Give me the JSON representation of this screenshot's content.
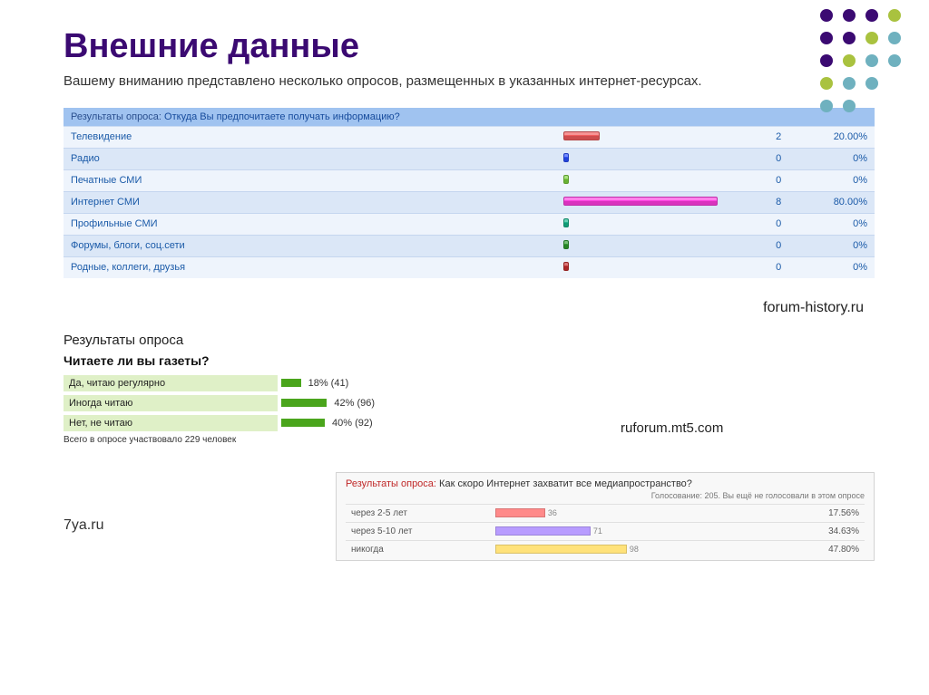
{
  "title": "Внешние данные",
  "subtitle": "Вашему вниманию представлено несколько опросов, размещенных в указанных интернет-ресурсах.",
  "poll1": {
    "headerPrefix": "Результаты опроса:",
    "question": "Откуда Вы предпочитаете получать информацию?",
    "rows": [
      {
        "label": "Телевидение",
        "count": "2",
        "pct": "20.00%",
        "barW": 40,
        "color": "#f15b5b"
      },
      {
        "label": "Радио",
        "count": "0",
        "pct": "0%",
        "barW": 6,
        "color": "#2a4fff"
      },
      {
        "label": "Печатные СМИ",
        "count": "0",
        "pct": "0%",
        "barW": 6,
        "color": "#7bd13d"
      },
      {
        "label": "Интернет СМИ",
        "count": "8",
        "pct": "80.00%",
        "barW": 170,
        "color": "#ff3de0"
      },
      {
        "label": "Профильные СМИ",
        "count": "0",
        "pct": "0%",
        "barW": 6,
        "color": "#16b58a"
      },
      {
        "label": "Форумы, блоги, соц.сети",
        "count": "0",
        "pct": "0%",
        "barW": 6,
        "color": "#2e9c2e"
      },
      {
        "label": "Родные, коллеги, друзья",
        "count": "0",
        "pct": "0%",
        "barW": 6,
        "color": "#c73030"
      }
    ]
  },
  "source1": "forum-history.ru",
  "poll2": {
    "title": "Результаты опроса",
    "question": "Читаете ли вы газеты?",
    "rows": [
      {
        "label": "Да, читаю регулярно",
        "pct": 18,
        "count": 41,
        "text": "18% (41)"
      },
      {
        "label": "Иногда читаю",
        "pct": 42,
        "count": 96,
        "text": "42% (96)"
      },
      {
        "label": "Нет, не читаю",
        "pct": 40,
        "count": 92,
        "text": "40% (92)"
      }
    ],
    "total": "Всего в опросе участвовало 229 человек"
  },
  "source2": "ruforum.mt5.com",
  "source3": "7ya.ru",
  "poll3": {
    "headerPrefix": "Результаты опроса:",
    "question": "Как скоро Интернет захватит все медиапространство?",
    "sub": "Голосование: 205. Вы ещё не голосовали в этом опросе",
    "rows": [
      {
        "label": "через 2-5 лет",
        "count": "36",
        "pct": "17.56%",
        "barW": 55,
        "color": "#ff8a8a"
      },
      {
        "label": "через 5-10 лет",
        "count": "71",
        "pct": "34.63%",
        "barW": 105,
        "color": "#b89cff"
      },
      {
        "label": "никогда",
        "count": "98",
        "pct": "47.80%",
        "barW": 145,
        "color": "#ffe27a"
      }
    ]
  },
  "chart_data": [
    {
      "type": "bar",
      "title": "Откуда Вы предпочитаете получать информацию?",
      "categories": [
        "Телевидение",
        "Радио",
        "Печатные СМИ",
        "Интернет СМИ",
        "Профильные СМИ",
        "Форумы, блоги, соц.сети",
        "Родные, коллеги, друзья"
      ],
      "values": [
        2,
        0,
        0,
        8,
        0,
        0,
        0
      ],
      "percentages": [
        20.0,
        0,
        0,
        80.0,
        0,
        0,
        0
      ]
    },
    {
      "type": "bar",
      "title": "Читаете ли вы газеты?",
      "categories": [
        "Да, читаю регулярно",
        "Иногда читаю",
        "Нет, не читаю"
      ],
      "values": [
        41,
        96,
        92
      ],
      "percentages": [
        18,
        42,
        40
      ],
      "n": 229
    },
    {
      "type": "bar",
      "title": "Как скоро Интернет захватит все медиапространство?",
      "categories": [
        "через 2-5 лет",
        "через 5-10 лет",
        "никогда"
      ],
      "values": [
        36,
        71,
        98
      ],
      "percentages": [
        17.56,
        34.63,
        47.8
      ],
      "n": 205
    }
  ]
}
